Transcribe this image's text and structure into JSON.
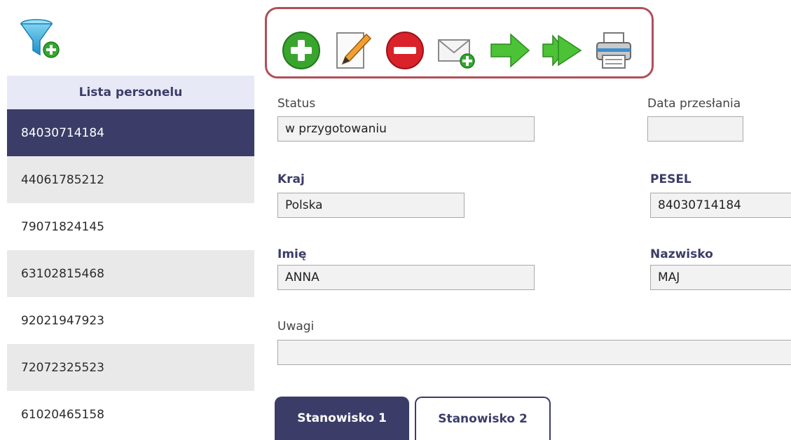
{
  "sidebar": {
    "filter_icon": "filter-add-icon",
    "header": "Lista personelu",
    "items": [
      {
        "label": "84030714184",
        "selected": true
      },
      {
        "label": "44061785212"
      },
      {
        "label": "79071824145"
      },
      {
        "label": "63102815468"
      },
      {
        "label": "92021947923"
      },
      {
        "label": "72072325523"
      },
      {
        "label": "61020465158"
      }
    ]
  },
  "toolbar": {
    "buttons": [
      {
        "name": "add-button",
        "icon": "plus-circle-icon"
      },
      {
        "name": "edit-button",
        "icon": "pencil-icon"
      },
      {
        "name": "delete-button",
        "icon": "minus-circle-icon"
      },
      {
        "name": "send-button",
        "icon": "envelope-add-icon"
      },
      {
        "name": "next-button",
        "icon": "arrow-right-icon"
      },
      {
        "name": "last-button",
        "icon": "double-arrow-right-icon"
      },
      {
        "name": "print-button",
        "icon": "printer-icon"
      }
    ],
    "highlight_color": "#b0505a"
  },
  "form": {
    "status": {
      "label": "Status",
      "value": "w przygotowaniu"
    },
    "data_przeslania": {
      "label": "Data przesłania",
      "value": ""
    },
    "kraj": {
      "label": "Kraj",
      "value": "Polska"
    },
    "pesel": {
      "label": "PESEL",
      "value": "84030714184"
    },
    "imie": {
      "label": "Imię",
      "value": "ANNA"
    },
    "nazwisko": {
      "label": "Nazwisko",
      "value": "MAJ"
    },
    "uwagi": {
      "label": "Uwagi",
      "value": ""
    }
  },
  "tabs": [
    {
      "label": "Stanowisko 1",
      "active": true
    },
    {
      "label": "Stanowisko 2",
      "active": false
    }
  ],
  "colors": {
    "primary": "#3b3d68",
    "header_bg": "#e8e9f6",
    "alt_row": "#e9e9e9"
  }
}
